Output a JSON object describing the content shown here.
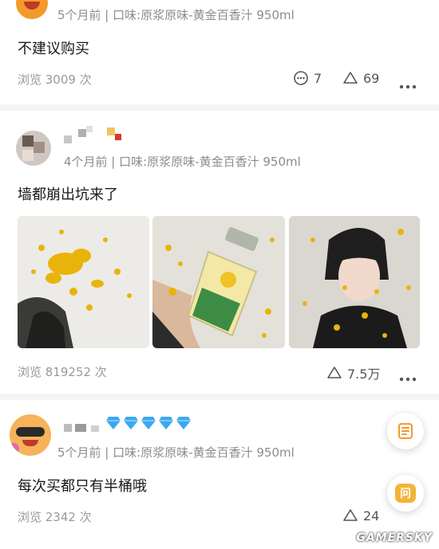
{
  "comments": [
    {
      "meta": "5个月前 | 口味:原浆原味-黄金百香汁 950ml",
      "text": "不建议购买",
      "views": "浏览 3009 次",
      "reply_count": "7",
      "like_count": "69"
    },
    {
      "meta": "4个月前 | 口味:原浆原味-黄金百香汁 950ml",
      "text": "墙都崩出坑来了",
      "views": "浏览 819252 次",
      "like_count": "7.5万"
    },
    {
      "meta": "5个月前 | 口味:原浆原味-黄金百香汁 950ml",
      "text": "每次买都只有半桶哦",
      "views": "浏览 2342 次",
      "like_count": "24"
    }
  ],
  "fab": {
    "ask_label": "问"
  },
  "watermark": "GAMERSKY",
  "icons": {
    "reply": "comment-bubble-icon",
    "like": "triangle-like-icon",
    "more": "more-dots-icon",
    "diamond": "diamond-icon",
    "note": "note-icon"
  },
  "colors": {
    "accent": "#f29a2e",
    "diamond": "#3aa9ef",
    "muted": "#8c8c8c"
  }
}
